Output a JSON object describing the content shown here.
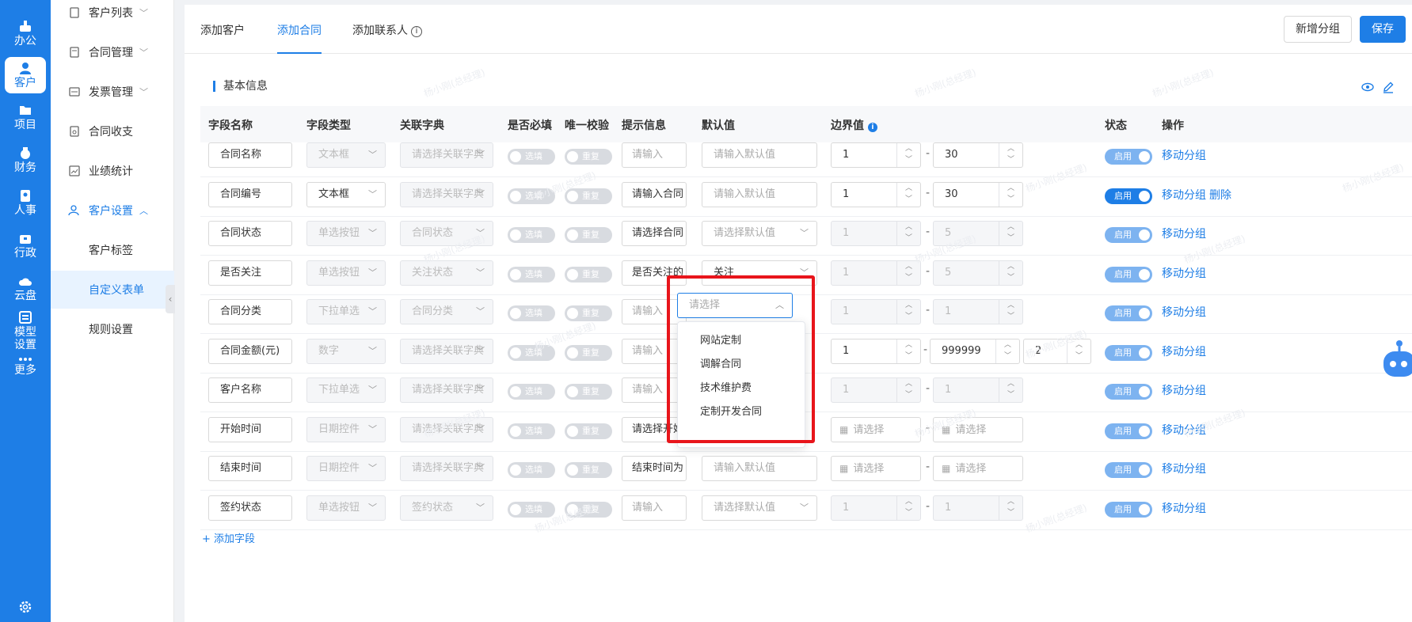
{
  "rail": {
    "items": [
      {
        "key": "office",
        "label": "办公",
        "icon": "office-icon"
      },
      {
        "key": "customer",
        "label": "客户",
        "icon": "user-icon"
      },
      {
        "key": "project",
        "label": "项目",
        "icon": "folder-icon"
      },
      {
        "key": "finance",
        "label": "财务",
        "icon": "money-bag-icon"
      },
      {
        "key": "hr",
        "label": "人事",
        "icon": "id-badge-icon"
      },
      {
        "key": "admin",
        "label": "行政",
        "icon": "briefcase-icon"
      },
      {
        "key": "cloud",
        "label": "云盘",
        "icon": "cloud-icon"
      },
      {
        "key": "model",
        "label": "模型设置",
        "icon": "model-icon"
      },
      {
        "key": "more",
        "label": "更多",
        "icon": "more-icon"
      }
    ],
    "settings_icon": "gear-icon"
  },
  "subnav": {
    "items": [
      {
        "label": "客户列表"
      },
      {
        "label": "合同管理"
      },
      {
        "label": "发票管理"
      },
      {
        "label": "合同收支"
      },
      {
        "label": "业绩统计"
      },
      {
        "label": "客户设置"
      },
      {
        "label": "客户标签"
      },
      {
        "label": "自定义表单"
      },
      {
        "label": "规则设置"
      }
    ]
  },
  "tabs": [
    {
      "label": "添加客户"
    },
    {
      "label": "添加合同"
    },
    {
      "label": "添加联系人"
    }
  ],
  "actions": {
    "new_group": "新增分组",
    "save": "保存"
  },
  "section": {
    "title": "基本信息"
  },
  "table": {
    "headers": [
      "字段名称",
      "字段类型",
      "关联字典",
      "是否必填",
      "唯一校验",
      "提示信息",
      "默认值",
      "边界值",
      "状态",
      "操作"
    ],
    "toggle_required": "选填",
    "toggle_unique": "重复",
    "toggle_status": "启用",
    "move_label": "移动分组",
    "delete_label": "删除",
    "rows": [
      {
        "name": "合同名称",
        "type": "文本框",
        "dict": "请选择关联字典",
        "hint": "请输入",
        "default": "请输入默认值",
        "min": "1",
        "max": "30"
      },
      {
        "name": "合同编号",
        "type": "文本框",
        "dict": "请选择关联字典",
        "hint": "请输入合同",
        "default": "请输入默认值",
        "min": "1",
        "max": "30",
        "delete": true
      },
      {
        "name": "合同状态",
        "type": "单选按钮",
        "dict": "合同状态",
        "hint": "请选择合同",
        "default": "请选择默认值",
        "min": "1",
        "max": "5"
      },
      {
        "name": "是否关注",
        "type": "单选按钮",
        "dict": "关注状态",
        "hint": "是否关注的",
        "default": "关注",
        "min": "1",
        "max": "5"
      },
      {
        "name": "合同分类",
        "type": "下拉单选",
        "dict": "合同分类",
        "hint": "请输入",
        "default": "请选择",
        "min": "1",
        "max": "1"
      },
      {
        "name": "合同金额(元)",
        "type": "数字",
        "dict": "请选择关联字典",
        "hint": "请输入",
        "default": "",
        "min": "1",
        "max": "999999",
        "precision": "2"
      },
      {
        "name": "客户名称",
        "type": "下拉单选",
        "dict": "请选择关联字典",
        "hint": "请输入",
        "default": "",
        "min": "1",
        "max": "1"
      },
      {
        "name": "开始时间",
        "type": "日期控件",
        "dict": "请选择关联字典",
        "hint": "请选择开始",
        "default": "",
        "min": "请选择",
        "max": "请选择"
      },
      {
        "name": "结束时间",
        "type": "日期控件",
        "dict": "请选择关联字典",
        "hint": "结束时间为",
        "default": "请输入默认值",
        "min": "请选择",
        "max": "请选择"
      },
      {
        "name": "签约状态",
        "type": "单选按钮",
        "dict": "签约状态",
        "hint": "请输入",
        "default": "请选择默认值",
        "min": "1",
        "max": "1"
      }
    ]
  },
  "dropdown": {
    "placeholder": "请选择",
    "options": [
      "网站定制",
      "调解合同",
      "技术维护费",
      "定制开发合同"
    ]
  },
  "add_field": "+ 添加字段",
  "watermark": "杨小刚(总经理)",
  "colors": {
    "primary": "#1e7ee6",
    "highlight": "#e8151b"
  }
}
